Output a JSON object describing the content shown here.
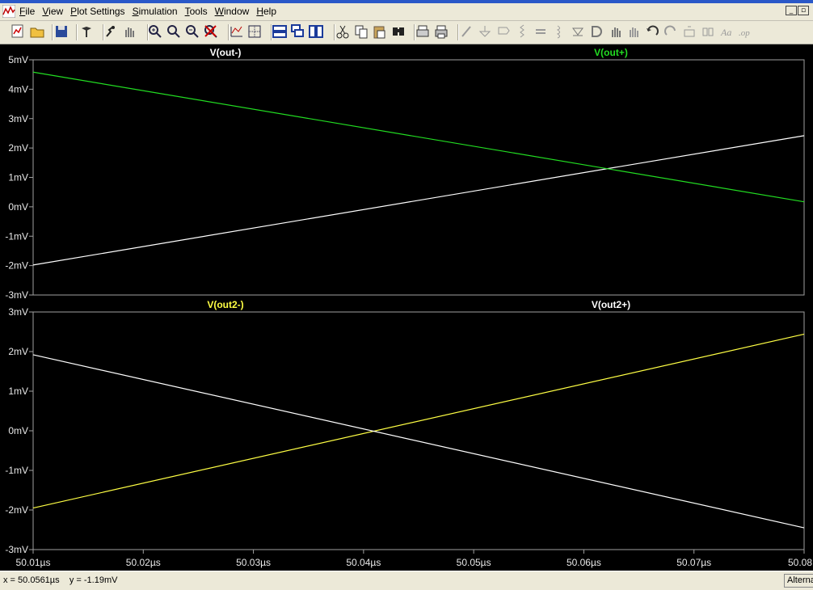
{
  "menubar": {
    "items": [
      {
        "accel": "F",
        "rest": "ile"
      },
      {
        "accel": "V",
        "rest": "iew"
      },
      {
        "accel": "P",
        "rest": "lot Settings"
      },
      {
        "accel": "S",
        "rest": "imulation"
      },
      {
        "accel": "T",
        "rest": "ools"
      },
      {
        "accel": "W",
        "rest": "indow"
      },
      {
        "accel": "H",
        "rest": "elp"
      }
    ],
    "minimize_glyph": "_",
    "restore_glyph": "▫"
  },
  "toolbar": {
    "buttons": [
      "new-schematic",
      "open",
      "save",
      "control-panel",
      "run",
      "halt",
      "zoom-area",
      "zoom-in",
      "zoom-out",
      "zoom-cancel",
      "autorange",
      "grid",
      "tile-horizontal",
      "cascade",
      "tile-vertical",
      "cut",
      "copy",
      "paste",
      "find",
      "print-preview",
      "print",
      "draw-wire",
      "ground",
      "label-net",
      "resistor",
      "capacitor",
      "inductor",
      "diode",
      "component",
      "move",
      "drag",
      "undo",
      "redo",
      "rotate",
      "mirror",
      "text",
      "spice-directive"
    ]
  },
  "colors": {
    "plot_bg": "#000000",
    "axis": "#a0a0a0",
    "trace_white": "#ffffff",
    "trace_green": "#22dd22",
    "trace_yellow": "#ffff44"
  },
  "chart_data": [
    {
      "type": "line",
      "pane": "top",
      "xlabel": "",
      "ylabel": "",
      "xlim": [
        50.01,
        50.08
      ],
      "ylim": [
        -3,
        5
      ],
      "yticks": [
        "5mV",
        "4mV",
        "3mV",
        "2mV",
        "1mV",
        "0mV",
        "-1mV",
        "-2mV",
        "-3mV"
      ],
      "series": [
        {
          "name": "V(out-)",
          "color": "#ffffff",
          "x": [
            50.01,
            50.08
          ],
          "y": [
            -1.98,
            2.42
          ]
        },
        {
          "name": "V(out+)",
          "color": "#22dd22",
          "x": [
            50.01,
            50.08
          ],
          "y": [
            4.58,
            0.17
          ]
        }
      ],
      "grid": false
    },
    {
      "type": "line",
      "pane": "bottom",
      "xlabel": "",
      "ylabel": "",
      "xlim": [
        50.01,
        50.08
      ],
      "ylim": [
        -3,
        3
      ],
      "yticks": [
        "3mV",
        "2mV",
        "1mV",
        "0mV",
        "-1mV",
        "-2mV",
        "-3mV"
      ],
      "xticks": [
        "50.01µs",
        "50.02µs",
        "50.03µs",
        "50.04µs",
        "50.05µs",
        "50.06µs",
        "50.07µs",
        "50.08"
      ],
      "series": [
        {
          "name": "V(out2-)",
          "color": "#ffff44",
          "x": [
            50.01,
            50.08
          ],
          "y": [
            -1.95,
            2.44
          ]
        },
        {
          "name": "V(out2+)",
          "color": "#ffffff",
          "x": [
            50.01,
            50.08
          ],
          "y": [
            1.92,
            -2.45
          ]
        }
      ],
      "grid": false
    }
  ],
  "status": {
    "readout": "x = 50.0561µs    y = -1.19mV",
    "mode": "Alternate"
  }
}
